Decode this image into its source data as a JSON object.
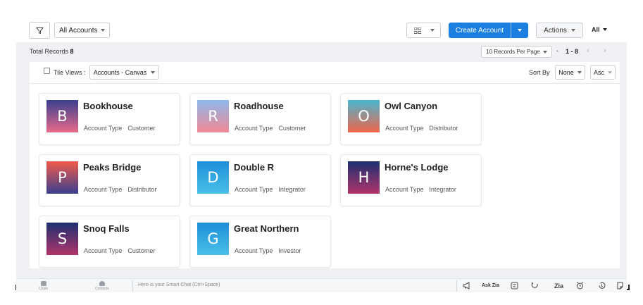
{
  "toolbar": {
    "filter_icon": "funnel-icon",
    "view_label": "All Accounts",
    "layout_icon": "grid-icon",
    "create_label": "Create Account",
    "actions_label": "Actions",
    "all_label": "All",
    "accent": "#1a7fe0"
  },
  "records": {
    "total_label": "Total Records",
    "total_count": "8",
    "per_page": "10 Records Per Page",
    "separator": "•",
    "range": "1 - 8",
    "prev": "‹",
    "next": "›"
  },
  "tile_bar": {
    "tile_views_label": "Tile Views :",
    "canvas_value": "Accounts - Canvas",
    "sort_label": "Sort By",
    "sort_value": "None",
    "order_value": "Asc"
  },
  "cards": [
    {
      "initial": "B",
      "name": "Bookhouse",
      "type_label": "Account Type",
      "type": "Customer",
      "gradient": [
        "#3a3f8f",
        "#e86a8a"
      ]
    },
    {
      "initial": "R",
      "name": "Roadhouse",
      "type_label": "Account Type",
      "type": "Customer",
      "gradient": [
        "#8fb8ec",
        "#f08a94"
      ]
    },
    {
      "initial": "O",
      "name": "Owl Canyon",
      "type_label": "Account Type",
      "type": "Distributor",
      "gradient": [
        "#4ab6cf",
        "#f0654a"
      ]
    },
    {
      "initial": "P",
      "name": "Peaks Bridge",
      "type_label": "Account Type",
      "type": "Distributor",
      "gradient": [
        "#f05a4a",
        "#3a3f8f"
      ]
    },
    {
      "initial": "D",
      "name": "Double R",
      "type_label": "Account Type",
      "type": "Integrator",
      "gradient": [
        "#1f8ed8",
        "#4ac0e8"
      ]
    },
    {
      "initial": "H",
      "name": "Horne's Lodge",
      "type_label": "Account Type",
      "type": "Integrator",
      "gradient": [
        "#1d2f70",
        "#b0356a"
      ]
    },
    {
      "initial": "S",
      "name": "Snoq Falls",
      "type_label": "Account Type",
      "type": "Customer",
      "gradient": [
        "#1d2f70",
        "#b0356a"
      ]
    },
    {
      "initial": "G",
      "name": "Great Northern",
      "type_label": "Account Type",
      "type": "Investor",
      "gradient": [
        "#1f8ed8",
        "#4ac0e8"
      ]
    }
  ],
  "bottom_bar": {
    "chats_label": "Chats",
    "contacts_label": "Contacts",
    "smart_chat_placeholder": "Here is your Smart Chat (Ctrl+Space)",
    "ask_zia_label": "Ask Zia",
    "icons": [
      "megaphone-icon",
      "zia-agent-icon",
      "feedback-icon",
      "zia-text-icon",
      "alarm-icon",
      "history-icon",
      "notes-icon"
    ]
  }
}
